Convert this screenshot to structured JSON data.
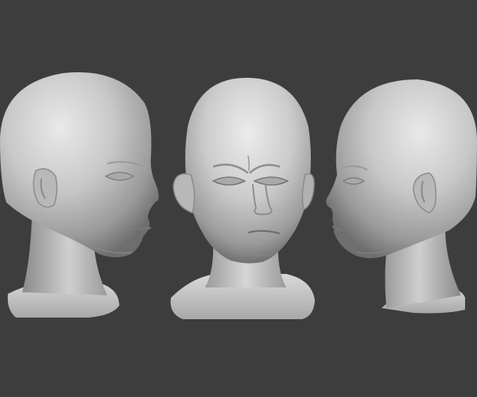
{
  "scene": {
    "background_color": "#3d3d3d",
    "material_color": "#c9c9c9",
    "views": [
      {
        "name": "left-profile"
      },
      {
        "name": "front"
      },
      {
        "name": "right-profile"
      }
    ]
  }
}
